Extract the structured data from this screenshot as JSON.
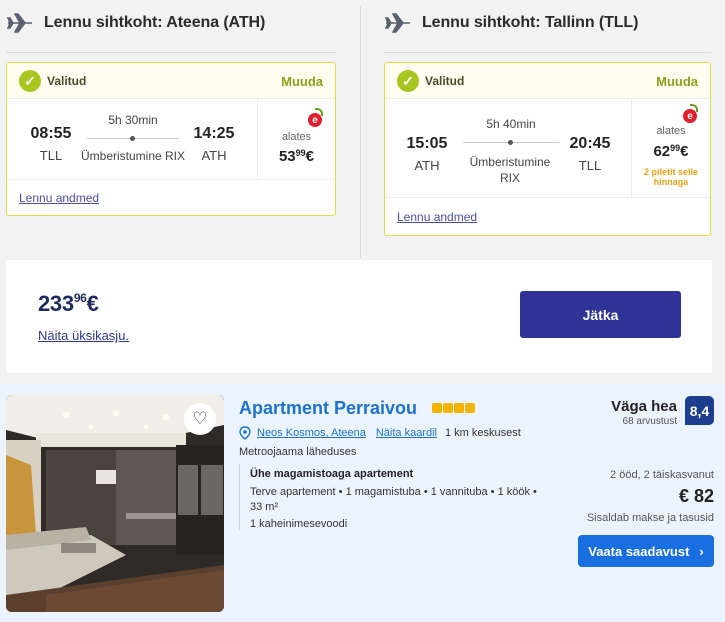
{
  "flights": {
    "outbound": {
      "title": "Lennu sihtkoht: Ateena (ATH)",
      "status": "Valitud",
      "change": "Muuda",
      "depart_time": "08:55",
      "depart_code": "TLL",
      "arrive_time": "14:25",
      "arrive_code": "ATH",
      "duration": "5h 30min",
      "via": "Ümberistumine RIX",
      "from_label": "alates",
      "price_main": "53",
      "price_cents": "99",
      "currency": "€",
      "details_link": "Lennu andmed"
    },
    "return": {
      "title": "Lennu sihtkoht: Tallinn (TLL)",
      "status": "Valitud",
      "change": "Muuda",
      "depart_time": "15:05",
      "depart_code": "ATH",
      "arrive_time": "20:45",
      "arrive_code": "TLL",
      "duration": "5h 40min",
      "via_line1": "Ümberistumine",
      "via_line2": "RIX",
      "from_label": "alates",
      "price_main": "62",
      "price_cents": "99",
      "currency": "€",
      "promo_line1": "2 piletit selle",
      "promo_line2": "hinnaga",
      "details_link": "Lennu andmed"
    }
  },
  "total": {
    "price_main": "233",
    "price_cents": "96",
    "currency": "€",
    "breakdown_link": "Näita üksikasju.",
    "continue_label": "Jätka"
  },
  "hotel": {
    "name": "Apartment Perraivou",
    "stars": 4,
    "location": "Neos Kosmos, Ateena",
    "map_link": "Näita kaardil",
    "distance": "1 km keskusest",
    "metro": "Metroojaama läheduses",
    "unit_title": "Ühe magamistoaga apartement",
    "unit_desc": "Terve apartement • 1 magamistuba • 1 vannituba • 1 köök • 33 m²",
    "bed": "1 kaheinimesevoodi",
    "rating_word": "Väga hea",
    "rating_count": "68 arvustust",
    "score": "8,4",
    "nights_guests": "2 ööd, 2 täiskasvanut",
    "price": "€ 82",
    "taxes": "Sisaldab makse ja tasusid",
    "availability_label": "Vaata saadavust",
    "availability_chevron": "›"
  },
  "colors": {
    "selected_green": "#a8c520",
    "card_border": "#e3d84a",
    "continue_button": "#2e3495",
    "hotel_link": "#1d73c9",
    "score_badge": "#1d3e8f",
    "availability_button": "#1a6fe0",
    "star": "#f4b400"
  },
  "icons": {
    "plane": "airplane-icon",
    "check": "checkmark-icon",
    "cherry": "cherry-e-icon",
    "heart": "heart-icon",
    "pin": "map-pin-icon",
    "chevron": "chevron-right-icon"
  }
}
